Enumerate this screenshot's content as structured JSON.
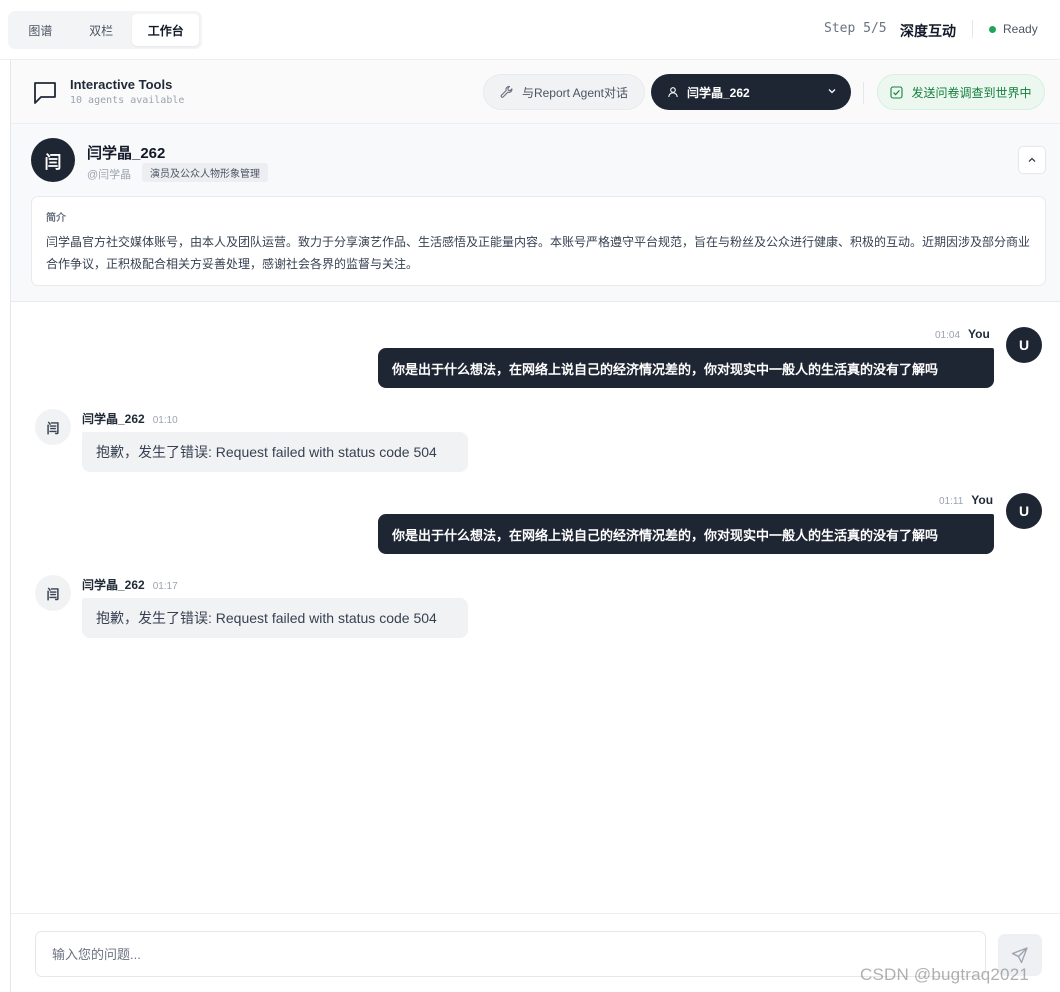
{
  "view_tabs": [
    "图谱",
    "双栏",
    "工作台"
  ],
  "active_view_tab": "工作台",
  "step": {
    "label": "Step 5/5",
    "title": "深度互动"
  },
  "status": {
    "text": "Ready",
    "color": "#22a55a"
  },
  "tools": {
    "title": "Interactive Tools",
    "subtitle": "10 agents available",
    "report_button": "与Report Agent对话",
    "agent_select": "闫学晶_262",
    "survey_button": "发送问卷调查到世界中"
  },
  "profile": {
    "avatar": "闫",
    "name": "闫学晶_262",
    "handle": "@闫学晶",
    "tag": "演员及公众人物形象管理",
    "bio_label": "简介",
    "bio_text": "闫学晶官方社交媒体账号，由本人及团队运营。致力于分享演艺作品、生活感悟及正能量内容。本账号严格遵守平台规范，旨在与粉丝及公众进行健康、积极的互动。近期因涉及部分商业合作争议，正积极配合相关方妥善处理，感谢社会各界的监督与关注。"
  },
  "messages": [
    {
      "role": "user",
      "name": "You",
      "avatar": "U",
      "time": "01:04",
      "text": "你是出于什么想法，在网络上说自己的经济情况差的，你对现实中一般人的生活真的没有了解吗"
    },
    {
      "role": "agent",
      "name": "闫学晶_262",
      "avatar": "闫",
      "time": "01:10",
      "text": "抱歉，发生了错误: Request failed with status code 504"
    },
    {
      "role": "user",
      "name": "You",
      "avatar": "U",
      "time": "01:11",
      "text": "你是出于什么想法，在网络上说自己的经济情况差的，你对现实中一般人的生活真的没有了解吗"
    },
    {
      "role": "agent",
      "name": "闫学晶_262",
      "avatar": "闫",
      "time": "01:17",
      "text": "抱歉，发生了错误: Request failed with status code 504"
    }
  ],
  "input": {
    "placeholder": "输入您的问题...",
    "value": ""
  },
  "watermark": "CSDN @bugtraq2021"
}
